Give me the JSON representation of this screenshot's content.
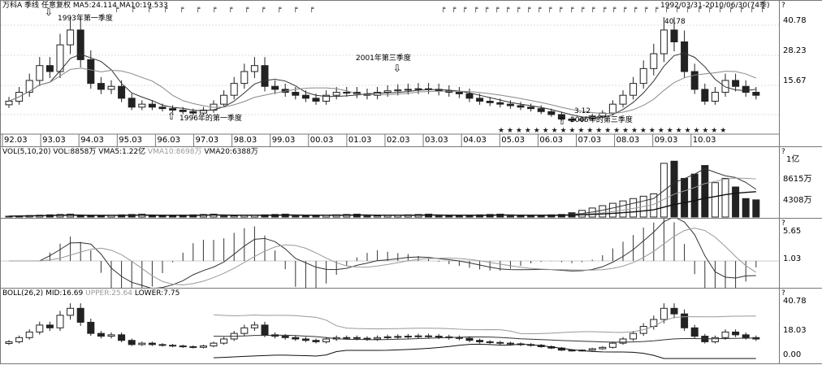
{
  "header": {
    "stock": "万科A",
    "period": "季线",
    "adjust": "任意复权",
    "ma5_label": "MA5:24.114",
    "ma10_label": "MA10:19.533",
    "range": "1992/03/31-2010/06/30(74季)"
  },
  "main": {
    "y_labels": [
      "40.78",
      "28.23",
      "15.67"
    ],
    "annotations": [
      "1993年第一季度",
      "1996年的第一季度",
      "2001年第三季度",
      "2005年的第三季度"
    ],
    "peak_label": "40.78",
    "low_label": "3.12",
    "x_labels": [
      "92.03",
      "93.03",
      "94.03",
      "95.03",
      "96.03",
      "97.03",
      "98.03",
      "99.03",
      "00.03",
      "01.03",
      "02.03",
      "03.03",
      "04.03",
      "05.03",
      "06.03",
      "07.03",
      "08.03",
      "09.03",
      "10.03"
    ],
    "stars": "★ ★ ★ ★ ★ ★ ★ ★ ★ ★ ★ ★ ★ ★ ★ ★ ★ ★ ★ ★ ★ ★ ★ ★ ★ ★",
    "flag_marks": "╒"
  },
  "volume": {
    "title": "VOL(5,10,20)",
    "vol_label": "VOL:8858万",
    "vma5_label": "VMA5:1.22亿",
    "vma10_label": "VMA10:8698万",
    "vma20_label": "VMA20:6388万",
    "y_labels": [
      "1亿",
      "8615万",
      "4308万"
    ]
  },
  "macd": {
    "y_labels": [
      "5.65",
      "1.03"
    ]
  },
  "boll": {
    "title": "BOLL(26,2)",
    "mid_label": "MID:16.69",
    "upper_label": "UPPER:25.64",
    "lower_label": "LOWER:7.75",
    "y_labels": [
      "40.78",
      "18.03",
      "0.00"
    ]
  },
  "help_mark": "?",
  "chart_data": {
    "type": "candlestick",
    "periods": 74,
    "closes": [
      12,
      15,
      19,
      24,
      22,
      31,
      36,
      26,
      18,
      16,
      17,
      13,
      10,
      11,
      10,
      9.5,
      9,
      8.5,
      8,
      9,
      11,
      14,
      18,
      22,
      24,
      17,
      16,
      15,
      14,
      13,
      12,
      14,
      15,
      15,
      14.5,
      14,
      15,
      15.5,
      15.8,
      16,
      16.2,
      16,
      15.5,
      15,
      14.5,
      13,
      12,
      11.5,
      11,
      10.5,
      10,
      9.5,
      8.5,
      7.5,
      6,
      5.5,
      6,
      7,
      8,
      11,
      14,
      18,
      23,
      28,
      36,
      32,
      22,
      16,
      12,
      15,
      19,
      17,
      15,
      14
    ]
  }
}
